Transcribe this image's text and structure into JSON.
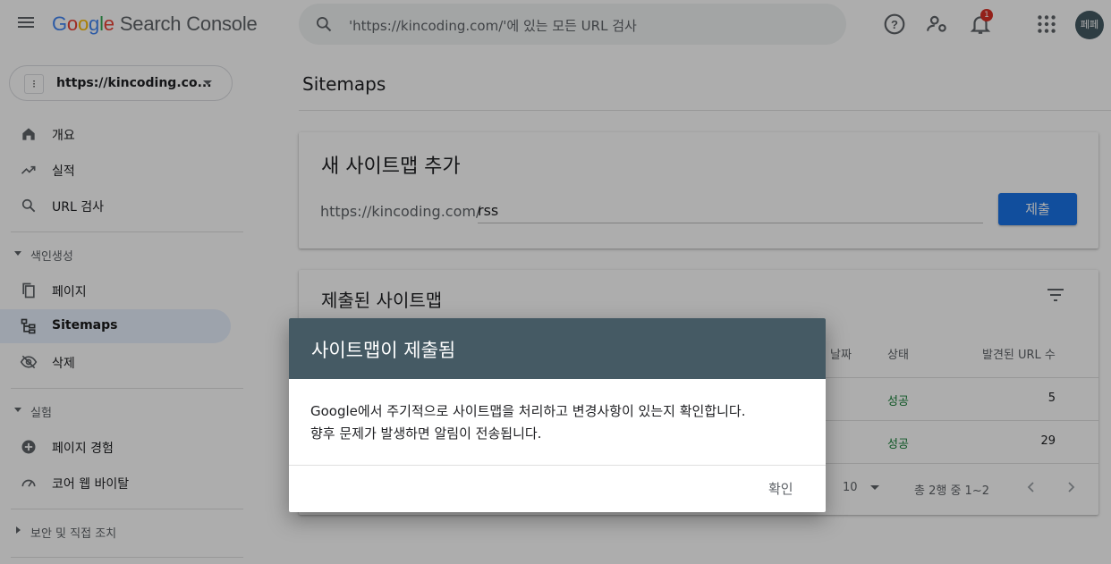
{
  "header": {
    "logo_google": [
      "G",
      "o",
      "o",
      "g",
      "l",
      "e"
    ],
    "logo_product": "Search Console",
    "search_placeholder": "'https://kincoding.com/'에 있는 모든 URL 검사",
    "notification_count": "1",
    "avatar_text": "페페",
    "icons": [
      "menu-icon",
      "search-icon",
      "help-icon",
      "manage-users-icon",
      "bell-icon",
      "apps-icon"
    ]
  },
  "sidebar": {
    "property": "https://kincoding.co...",
    "property_icon": "⁝",
    "top_items": [
      {
        "label": "개요",
        "icon": "home-icon"
      },
      {
        "label": "실적",
        "icon": "trending-icon"
      },
      {
        "label": "URL 검사",
        "icon": "search-icon"
      }
    ],
    "sections": [
      {
        "label": "색인생성",
        "items": [
          {
            "label": "페이지",
            "icon": "pages-icon"
          },
          {
            "label": "Sitemaps",
            "icon": "sitemap-icon",
            "active": true
          },
          {
            "label": "삭제",
            "icon": "removal-icon"
          }
        ]
      },
      {
        "label": "실험",
        "items": [
          {
            "label": "페이지 경험",
            "icon": "plus-circle-icon"
          },
          {
            "label": "코어 웹 바이탈",
            "icon": "gauge-icon"
          }
        ]
      },
      {
        "label": "보안 및 직접 조치",
        "items": []
      }
    ]
  },
  "main": {
    "page_title": "Sitemaps",
    "add_card": {
      "title": "새 사이트맵 추가",
      "prefix": "https://kincoding.com/",
      "input_value": "rss",
      "submit_label": "제출"
    },
    "submitted_card": {
      "title": "제출된 사이트맵",
      "partial_col": "날짜",
      "columns": [
        "상태",
        "발견된 URL 수"
      ],
      "rows": [
        {
          "status": "성공",
          "urls": "5"
        },
        {
          "status": "성공",
          "urls": "29"
        }
      ],
      "rows_per_page": "10",
      "page_summary": "총 2행 중 1~2"
    }
  },
  "dialog": {
    "title": "사이트맵이 제출됨",
    "body_line1": "Google에서 주기적으로 사이트맵을 처리하고 변경사항이 있는지 확인합니다.",
    "body_line2": "향후 문제가 발생하면 알림이 전송됩니다.",
    "confirm_label": "확인"
  },
  "colors": {
    "accent": "#1a73e8",
    "dialog_header": "#455a64",
    "success": "#188038",
    "badge": "#d93025"
  }
}
